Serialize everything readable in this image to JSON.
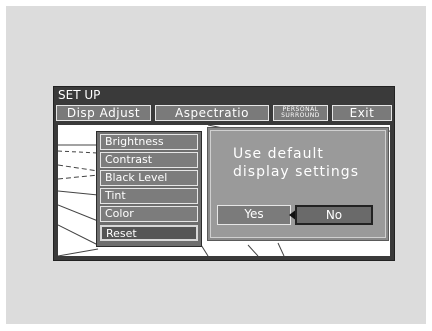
{
  "title": "SET UP",
  "menu": [
    {
      "label": "Disp Adjust"
    },
    {
      "label": "Aspectratio"
    },
    {
      "label": "PERSONAL\nSURROUND"
    },
    {
      "label": "Exit"
    }
  ],
  "adjust_items": [
    {
      "label": "Brightness"
    },
    {
      "label": "Contrast"
    },
    {
      "label": "Black Level"
    },
    {
      "label": "Tint"
    },
    {
      "label": "Color"
    },
    {
      "label": "Reset",
      "selected": true
    }
  ],
  "dialog": {
    "line1": "Use default",
    "line2": "display settings",
    "yes_label": "Yes",
    "no_label": "No",
    "selected": "No"
  },
  "colors": {
    "screen_bg": "#3a3a3a",
    "menu_bg": "#7a7a7a",
    "dialog_bg": "#9a9a9a"
  }
}
